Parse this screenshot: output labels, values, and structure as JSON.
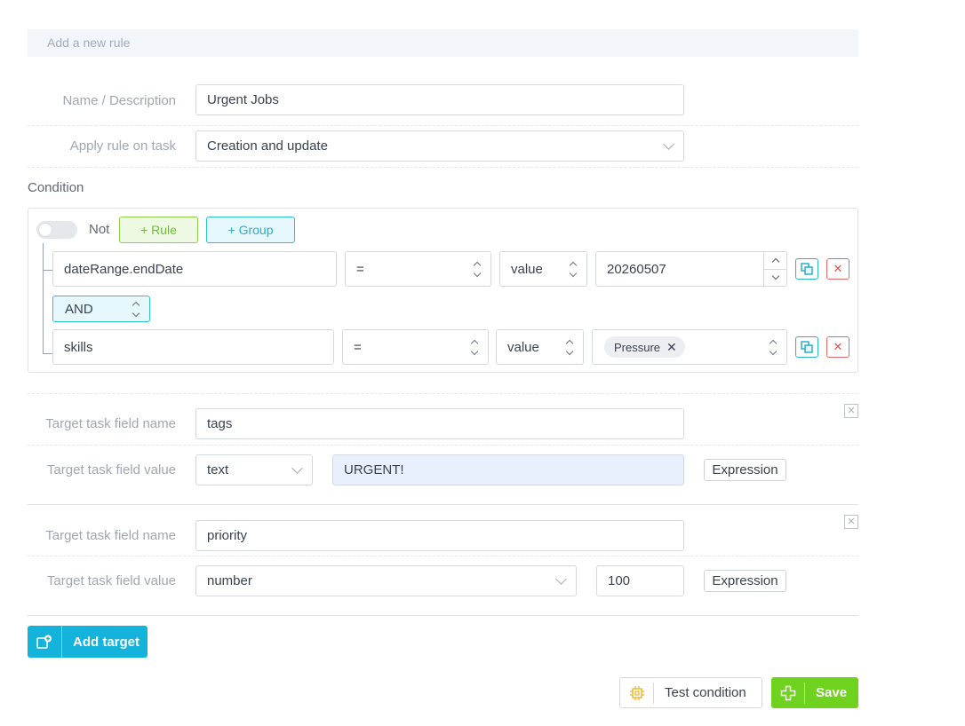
{
  "header": {
    "title": "Add a new rule"
  },
  "form": {
    "name_label": "Name / Description",
    "name_value": "Urgent Jobs",
    "apply_label": "Apply rule on task",
    "apply_value": "Creation and update"
  },
  "condition": {
    "title": "Condition",
    "not_label": "Not",
    "add_rule": "+ Rule",
    "add_group": "+ Group",
    "combinator": "AND",
    "rules": [
      {
        "field": "dateRange.endDate",
        "operator": "=",
        "value_source": "value",
        "value": "20260507"
      },
      {
        "field": "skills",
        "operator": "=",
        "value_source": "value",
        "tags": [
          "Pressure"
        ]
      }
    ]
  },
  "targets": [
    {
      "name_label": "Target task field name",
      "name_value": "tags",
      "value_label": "Target task field value",
      "type": "text",
      "value": "URGENT!",
      "expression_label": "Expression"
    },
    {
      "name_label": "Target task field name",
      "name_value": "priority",
      "value_label": "Target task field value",
      "type": "number",
      "value": "100",
      "expression_label": "Expression"
    }
  ],
  "actions": {
    "add_target": "Add target",
    "test_condition": "Test condition",
    "save": "Save"
  },
  "colors": {
    "accent_blue": "#13b3dc",
    "accent_green": "#6ed21e",
    "teal": "#2cc0d8",
    "danger": "#e34d4d"
  }
}
